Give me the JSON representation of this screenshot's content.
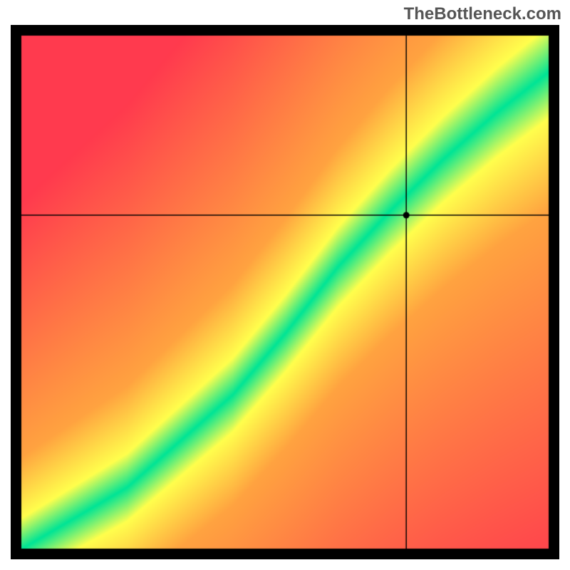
{
  "watermark": "TheBottleneck.com",
  "chart_data": {
    "type": "heatmap",
    "title": "",
    "xlabel": "",
    "ylabel": "",
    "xlim": [
      0,
      100
    ],
    "ylim": [
      0,
      100
    ],
    "crosshair": {
      "x": 73,
      "y": 65
    },
    "description": "Bottleneck heatmap showing optimal CPU-GPU pairing. Green diagonal band indicates balanced combinations, yellow indicates minor bottleneck, red/orange indicates severe bottleneck.",
    "color_scale": {
      "optimal": "#00E596",
      "good": "#FFFF4D",
      "moderate": "#FFA340",
      "poor": "#FF3A4E"
    },
    "optimal_curve_points": [
      {
        "x": 0,
        "y": 0
      },
      {
        "x": 20,
        "y": 12
      },
      {
        "x": 40,
        "y": 30
      },
      {
        "x": 50,
        "y": 42
      },
      {
        "x": 60,
        "y": 55
      },
      {
        "x": 70,
        "y": 66
      },
      {
        "x": 80,
        "y": 76
      },
      {
        "x": 90,
        "y": 85
      },
      {
        "x": 100,
        "y": 93
      }
    ],
    "band_width": 8
  }
}
